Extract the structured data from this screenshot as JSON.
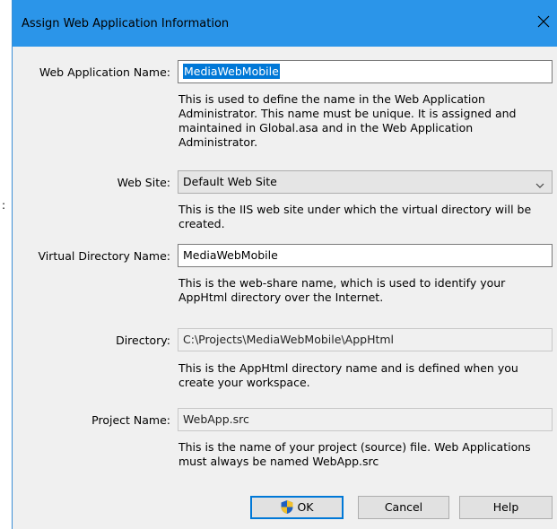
{
  "window": {
    "title": "Assign Web Application Information",
    "close_glyph": "✕"
  },
  "outside": {
    "mark": ":"
  },
  "fields": {
    "web_app_name": {
      "label": "Web Application Name:",
      "value": "MediaWebMobile",
      "help": "This is used to define the name in the Web Application Administrator. This name must be unique. It is assigned and maintained in Global.asa and in the Web Application Administrator."
    },
    "web_site": {
      "label": "Web Site:",
      "value": "Default Web Site",
      "help": "This is the IIS web site under which the virtual directory will be created."
    },
    "virtual_dir": {
      "label": "Virtual Directory Name:",
      "value": "MediaWebMobile",
      "help": "This is the web-share name, which is used to identify your AppHtml directory over the Internet."
    },
    "directory": {
      "label": "Directory:",
      "value": "C:\\Projects\\MediaWebMobile\\AppHtml",
      "help": "This is the AppHtml directory name and is defined when you create your workspace."
    },
    "project_name": {
      "label": "Project Name:",
      "value": "WebApp.src",
      "help": "This is the name of your project (source) file. Web Applications must always be named WebApp.src"
    }
  },
  "buttons": {
    "ok": "OK",
    "cancel": "Cancel",
    "help": "Help"
  },
  "icons": {
    "shield": "uac-shield-icon",
    "close": "close-icon",
    "dropdown": "chevron-down-icon"
  },
  "colors": {
    "titlebar": "#2b95e9",
    "selection": "#0078d7",
    "shield_blue": "#1f5fbf",
    "shield_gold": "#f2c02c"
  }
}
